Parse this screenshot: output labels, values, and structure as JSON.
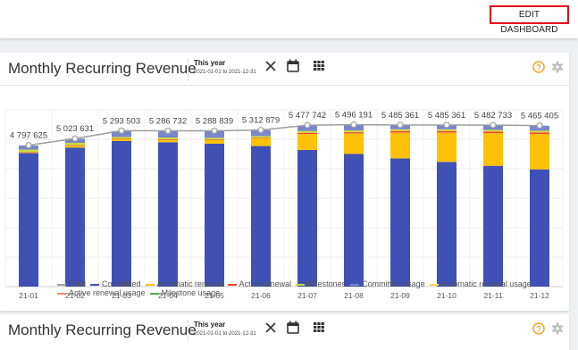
{
  "header": {
    "edit_button": "EDIT DASHBOARD"
  },
  "widgets": [
    {
      "title": "Monthly Recurring Revenue",
      "period_label": "This year",
      "period_range": "2021-01-01 to 2021-12-31"
    },
    {
      "title": "Monthly Recurring Revenue",
      "period_label": "This year",
      "period_range": "2021-01-01 to 2021-12-31"
    }
  ],
  "colors": {
    "total": "#9e9e9e",
    "committed": "#3f51b5",
    "automatic_renewal": "#ffc107",
    "active_renewal": "#f44336",
    "milestones": "#cddc39",
    "committed_usage": "#7986cb",
    "automatic_renewal_usage": "#ffd54f",
    "active_renewal_usage": "#ff8a65",
    "milestone_usage": "#4caf50",
    "highlight": "#e3001b"
  },
  "icons": [
    "close-icon",
    "calendar-icon",
    "grid-icon",
    "help-icon",
    "gear-icon"
  ],
  "chart_data": {
    "type": "bar",
    "stacked": true,
    "categories": [
      "21-01",
      "21-02",
      "21-03",
      "21-04",
      "21-05",
      "21-06",
      "21-07",
      "21-08",
      "21-09",
      "21-10",
      "21-11",
      "21-12"
    ],
    "ylim": [
      0,
      6000000
    ],
    "grid": true,
    "legend_position": "bottom",
    "series": [
      {
        "name": "Committed",
        "color": "#3f51b5",
        "values": [
          4530000,
          4720000,
          4940000,
          4900000,
          4850000,
          4770000,
          4640000,
          4500000,
          4350000,
          4230000,
          4100000,
          3980000
        ]
      },
      {
        "name": "Automatic renewal",
        "color": "#ffc107",
        "values": [
          20000,
          60000,
          60000,
          80000,
          120000,
          260000,
          540000,
          700000,
          880000,
          1000000,
          1110000,
          1200000
        ]
      },
      {
        "name": "Active renewal",
        "color": "#f44336",
        "values": [
          20000,
          20000,
          20000,
          20000,
          20000,
          20000,
          40000,
          40000,
          50000,
          50000,
          50000,
          50000
        ]
      },
      {
        "name": "Milestones",
        "color": "#cddc39",
        "values": [
          80000,
          80000,
          60000,
          60000,
          60000,
          60000,
          60000,
          60000,
          60000,
          60000,
          60000,
          60000
        ]
      },
      {
        "name": "Committed usage",
        "color": "#7986cb",
        "values": [
          140000,
          140000,
          200000,
          220000,
          230000,
          200000,
          190000,
          190000,
          140000,
          140000,
          160000,
          170000
        ]
      },
      {
        "name": "Automatic renewal usage",
        "color": "#ffd54f",
        "values": [
          0,
          0,
          0,
          0,
          0,
          0,
          0,
          0,
          0,
          0,
          0,
          0
        ]
      },
      {
        "name": "Active renewal usage",
        "color": "#ff8a65",
        "values": [
          0,
          0,
          0,
          0,
          0,
          0,
          0,
          0,
          0,
          0,
          0,
          0
        ]
      },
      {
        "name": "Milestone usage",
        "color": "#4caf50",
        "values": [
          0,
          0,
          0,
          0,
          0,
          0,
          0,
          0,
          0,
          0,
          0,
          0
        ]
      }
    ],
    "total": {
      "name": "Total",
      "color": "#9e9e9e",
      "values": [
        4797625,
        5023631,
        5293503,
        5286732,
        5288839,
        5312879,
        5477742,
        5496191,
        5485361,
        5485361,
        5482733,
        5465405
      ],
      "labels": [
        "4 797 625",
        "5 023 631",
        "5 293 503",
        "5 286 732",
        "5 288 839",
        "5 312 879",
        "5 477 742",
        "5 496 191",
        "5 485 361",
        "5 485 361",
        "5 482 733",
        "5 465 405"
      ]
    },
    "legend": [
      "Total",
      "Committed",
      "Automatic renewal",
      "Active renewal",
      "Milestones",
      "Committed usage",
      "Automatic renewal usage",
      "Active renewal usage",
      "Milestone usage"
    ]
  }
}
